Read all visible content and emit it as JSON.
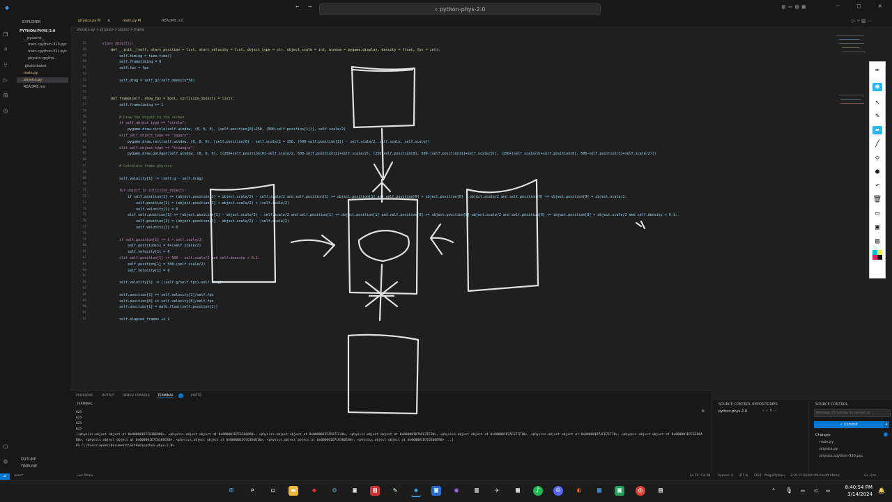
{
  "window": {
    "search_text": "python-phys-2.0"
  },
  "explorer": {
    "header": "EXPLORER",
    "root": "PYTHON-PHYS-2.0",
    "items": [
      {
        "label": "__pycache__"
      },
      {
        "label": "main.cpython-310.pyc"
      },
      {
        "label": "main.cpython-311.pyc"
      },
      {
        "label": "physics.cpytho..."
      },
      {
        "label": ".gitattributes"
      },
      {
        "label": "main.py"
      },
      {
        "label": "physics.py"
      },
      {
        "label": "README.md"
      }
    ],
    "outline": "OUTLINE",
    "timeline": "TIMELINE"
  },
  "tabs": [
    {
      "label": "physics.py M"
    },
    {
      "label": "main.py M"
    },
    {
      "label": "README.md"
    }
  ],
  "breadcrumb": "physics.py > physics > object > frame",
  "code_lines": [
    {
      "n": "15",
      "text": "class object():",
      "kind": "kw"
    },
    {
      "n": "16",
      "text": "    def __init__(self, start_position = list, start_velocity = list, object_type = str, object_scale = int, window = pygame.display, density = float, fps = int):",
      "kind": "df"
    },
    {
      "n": "49",
      "text": "        self.timing = time.time()",
      "kind": ""
    },
    {
      "n": "50",
      "text": "        self.frametiming = 0",
      "kind": ""
    },
    {
      "n": "51",
      "text": "        self.fps = fps",
      "kind": ""
    },
    {
      "n": "52",
      "text": "",
      "kind": ""
    },
    {
      "n": "53",
      "text": "        self.drag = self.g/(self.density*50)",
      "kind": ""
    },
    {
      "n": "54",
      "text": "",
      "kind": ""
    },
    {
      "n": "55",
      "text": "",
      "kind": ""
    },
    {
      "n": "56",
      "text": "    def frame(self, show_fps = bool, collision_objects = list):",
      "kind": "df"
    },
    {
      "n": "57",
      "text": "        self.frametiming += 1",
      "kind": ""
    },
    {
      "n": "58",
      "text": "",
      "kind": ""
    },
    {
      "n": "59",
      "text": "        # Draw the object to the screen",
      "kind": "cm"
    },
    {
      "n": "60",
      "text": "        if self.object_type == \"circle\":",
      "kind": "kw"
    },
    {
      "n": "61",
      "text": "            pygame.draw.circle(self.window, (0, 0, 0), [self.position[0]+250, (500-self.position[1])], self.scale/2)",
      "kind": ""
    },
    {
      "n": "62",
      "text": "        elif self.object_type == \"square\":",
      "kind": "kw"
    },
    {
      "n": "63",
      "text": "            pygame.draw.rect(self.window, (0, 0, 0), [self.position[0] - self.scale/2 + 250, (500-self.position[1]) - self.scale/2, self.scale, self.scale])",
      "kind": ""
    },
    {
      "n": "64",
      "text": "        elif self.object_type == \"triangle\":",
      "kind": "kw"
    },
    {
      "n": "65",
      "text": "            pygame.draw.polygon(self.window, (0, 0, 0), [(250+self.position[0]-self.scale/2, 500-self.position[1]+self.scale/2), (250+self.position[0], 500-(self.position[1]+self.scale/2)), (250+(self.scale/2)+self.position[0], 500-self.position[1]+self.scale/2)])",
      "kind": ""
    },
    {
      "n": "66",
      "text": "",
      "kind": ""
    },
    {
      "n": "67",
      "text": "        # Calculate frame physics",
      "kind": "cm"
    },
    {
      "n": "68",
      "text": "",
      "kind": ""
    },
    {
      "n": "69",
      "text": "        self.velocity[1] -= (self.g - self.drag)",
      "kind": ""
    },
    {
      "n": "70",
      "text": "",
      "kind": ""
    },
    {
      "n": "71",
      "text": "        for object in collision_objects:",
      "kind": "kw"
    },
    {
      "n": "72",
      "text": "            if self.position[1] <= (object.position[1] + object.scale/2) - self.scale/2 and self.position[1] >= object.position[1] and self.position[0] > object.position[0] - object.scale/2 and self.position[0] <= object.position[0] + object.scale/2:",
      "kind": ""
    },
    {
      "n": "73",
      "text": "                self.position[1] = (object.position[1] + object.scale/2) + (self.scale/2)",
      "kind": ""
    },
    {
      "n": "74",
      "text": "                self.velocity[1] = 0",
      "kind": ""
    },
    {
      "n": "75",
      "text": "            elif self.position[1] >= (object.position[1] - object.scale/2) - self.scale/2 and self.position[1] <= object.position[1] and self.position[0] >= object.position[0]-object.scale/2 and self.position[0] <= object.position[0] + object.scale/2 and self.density < 0.1:",
      "kind": ""
    },
    {
      "n": "76",
      "text": "                self.position[1] = (object.position[1] - object.scale/2) - (self.scale/2)",
      "kind": ""
    },
    {
      "n": "77",
      "text": "                self.velocity[1] = 0",
      "kind": ""
    },
    {
      "n": "78",
      "text": "",
      "kind": ""
    },
    {
      "n": "79",
      "text": "        if self.position[1] <= 0 + self.scale/2:",
      "kind": "kw"
    },
    {
      "n": "80",
      "text": "            self.position[1] = 0+(self.scale/2)",
      "kind": ""
    },
    {
      "n": "81",
      "text": "            self.velocity[1] = 0",
      "kind": ""
    },
    {
      "n": "82",
      "text": "        elif self.position[1] >= 500 - self.scale/2 and self.density < 0.1:",
      "kind": "kw"
    },
    {
      "n": "83",
      "text": "            self.position[1] = 500-(self.scale/2)",
      "kind": ""
    },
    {
      "n": "84",
      "text": "            self.velocity[1] = 0",
      "kind": ""
    },
    {
      "n": "85",
      "text": "",
      "kind": ""
    },
    {
      "n": "86",
      "text": "        self.velocity[1] -= ((self.g/self.fps)-self.drag)",
      "kind": ""
    },
    {
      "n": "87",
      "text": "",
      "kind": ""
    },
    {
      "n": "88",
      "text": "        self.position[1] += self.velocity[1]/self.fps",
      "kind": ""
    },
    {
      "n": "89",
      "text": "        self.position[0] += self.velocity[0]/self.fps",
      "kind": ""
    },
    {
      "n": "90",
      "text": "        self.position[1] = math.floor(self.position[1])",
      "kind": ""
    },
    {
      "n": "91",
      "text": "",
      "kind": ""
    },
    {
      "n": "92",
      "text": "        self.elapsed_frames += 1",
      "kind": ""
    }
  ],
  "panel": {
    "tabs": [
      "PROBLEMS",
      "OUTPUT",
      "DEBUG CONSOLE",
      "TERMINAL",
      "PORTS"
    ],
    "terminal_label": "TERMINAL",
    "lines": [
      "625",
      "625",
      "625",
      "625"
    ],
    "output": "[<physics.object object at 0x000001D7C6366980>, <physics.object object at 0x000001D7C6366B60>, <physics.object object at 0x000001D7AF67FF40>, <physics.object object at 0x000001D7AF67FFD0>, <physics.object object at 0x000001D7AF67FF10>, <physics.object object at 0x000001D7AF67FF70>, <physics.object object at 0x000001D7C6366AB0>, <physics.object object at 0x000001D7C6366C80>, <physics.object object at 0x000001D7C6366D10>, <physics.object object at 0x000001D7C6366E00>, <physics.object object at 0x000001D7C6366E90> ...]",
    "prompt": "PS C:\\Users\\openc\\Documents\\GitHub\\python-phys-2.0> "
  },
  "scm": {
    "repos_header": "SOURCE CONTROL REPOSITORIES",
    "repo": "python-phys-2.0",
    "header": "SOURCE CONTROL",
    "message_placeholder": "Message (Ctrl+Enter to commit on...",
    "commit_label": "✓ Commit",
    "changes_label": "Changes",
    "changes": [
      "main.py",
      "physics.py",
      "physics.cpython-310.pyc"
    ]
  },
  "statusbar": {
    "branch": "main*",
    "live_share": "Live Share",
    "position": "Ln 72, Col 94",
    "spaces": "Spaces: 4",
    "encoding": "UTF-8",
    "eol": "CRLF",
    "language": "MagicPython",
    "interpreter": "3.10.11 64-bit (Microsoft Store)",
    "golive": "Go Live"
  },
  "taskbar": {
    "time": "8:40:54 PM",
    "date": "3/14/2024"
  },
  "colors": {
    "accent": "#0078d4",
    "terminal_badge": "#0078d4"
  }
}
